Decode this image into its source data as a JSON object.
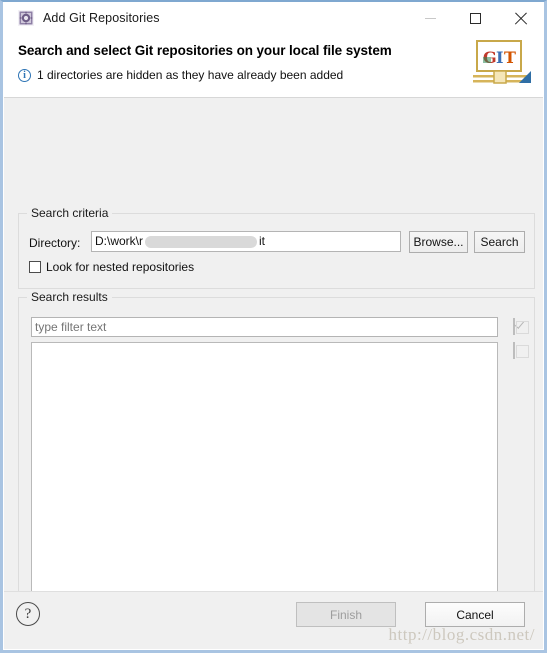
{
  "window": {
    "title": "Add Git Repositories",
    "icon": "git-repositories-icon",
    "controls": {
      "minimize": "Minimize",
      "maximize": "Maximize",
      "close": "Close"
    }
  },
  "header": {
    "title": "Search and select Git repositories on your local file system",
    "message": "1 directories are hidden as they have already been added",
    "info_icon": "info-icon",
    "logo": {
      "name": "git-logo",
      "letters": [
        "G",
        "I",
        "T"
      ],
      "colors": [
        "#c0392b",
        "#3a6fb5",
        "#d35400"
      ]
    }
  },
  "search_criteria": {
    "group_label": "Search criteria",
    "directory_label": "Directory:",
    "directory_value_prefix": "D:\\work\\r",
    "directory_value_suffix": "it",
    "directory_placeholder": "",
    "browse_label": "Browse...",
    "search_label": "Search",
    "nested_checkbox_label": "Look for nested repositories",
    "nested_checkbox_checked": false
  },
  "search_results": {
    "group_label": "Search results",
    "filter_placeholder": "type filter text",
    "filter_value": "",
    "items": [],
    "select_all_label": "Select All",
    "deselect_all_label": "Deselect All",
    "select_all_enabled": false,
    "deselect_all_enabled": false
  },
  "footer": {
    "help_label": "?",
    "finish_label": "Finish",
    "finish_enabled": false,
    "cancel_label": "Cancel",
    "cancel_enabled": true
  },
  "watermark": {
    "text": "http://blog.csdn.net/"
  },
  "theme": {
    "window_border": "#a9c4e2",
    "dialog_bg": "#f0f0f0",
    "header_bg": "#ffffff",
    "info_blue": "#2e74b5",
    "field_bg": "#ffffff"
  }
}
